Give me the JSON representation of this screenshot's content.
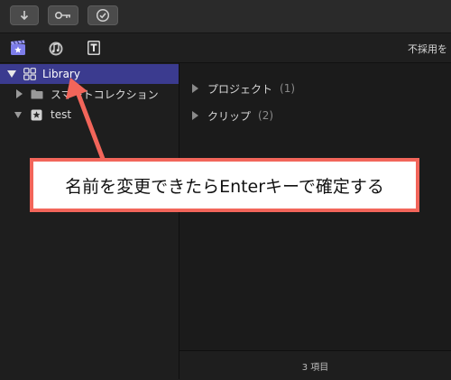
{
  "toolbar": {
    "buttons": [
      {
        "icon": "download-arrow-icon"
      },
      {
        "icon": "key-icon"
      },
      {
        "icon": "checkmark-circle-icon"
      }
    ]
  },
  "tabs": {
    "icons": [
      "clapperboard-star-icon",
      "music-notes-icon",
      "title-t-icon"
    ],
    "filter_label": "不採用を"
  },
  "sidebar": {
    "library_label": "Library",
    "smart_collection_label": "スマートコレクション",
    "event_label": "test"
  },
  "content": {
    "groups": [
      {
        "label": "プロジェクト",
        "count": "(1)"
      },
      {
        "label": "クリップ",
        "count": "(2)"
      }
    ],
    "status": "3 項目"
  },
  "annotation": {
    "text": "名前を変更できたらEnterキーで確定する",
    "color": "#f2655a"
  },
  "colors": {
    "selection": "#3b3b8f",
    "background": "#1e1e1e"
  }
}
